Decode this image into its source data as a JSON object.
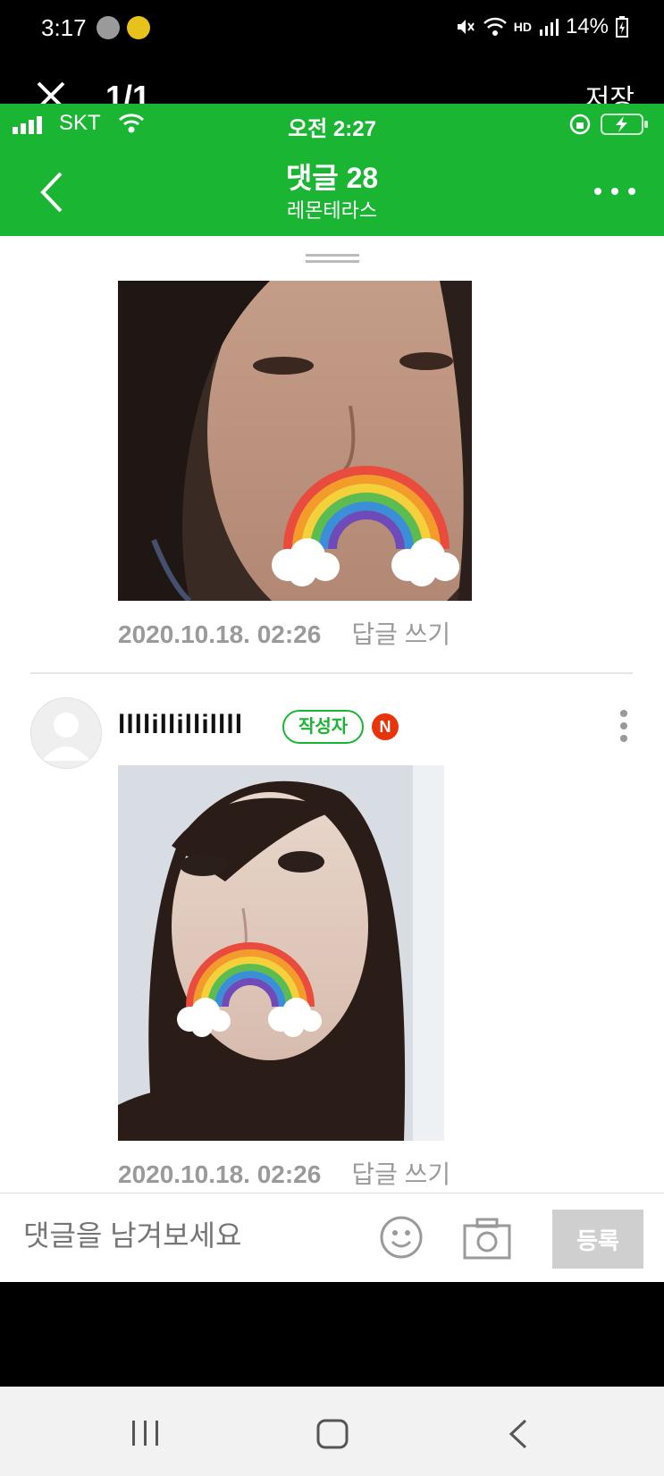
{
  "system_status": {
    "time": "3:17",
    "battery": "14%",
    "hd_label": "HD"
  },
  "viewer": {
    "counter": "1/1",
    "save_label": "저장"
  },
  "screenshot": {
    "ios_status": {
      "carrier": "SKT",
      "time": "오전 2:27"
    },
    "header": {
      "title": "댓글 28",
      "subtitle": "레몬테라스"
    },
    "comments": [
      {
        "date": "2020.10.18. 02:26",
        "reply_label": "답글 쓰기"
      },
      {
        "nickname": "llllillillillll",
        "author_badge": "작성자",
        "new_badge": "N",
        "date": "2020.10.18. 02:26",
        "reply_label": "답글 쓰기"
      }
    ],
    "composer": {
      "placeholder": "댓글을 남겨보세요",
      "submit_label": "등록"
    }
  },
  "colors": {
    "brand_green": "#1bb534",
    "new_badge_red": "#e8340b"
  }
}
